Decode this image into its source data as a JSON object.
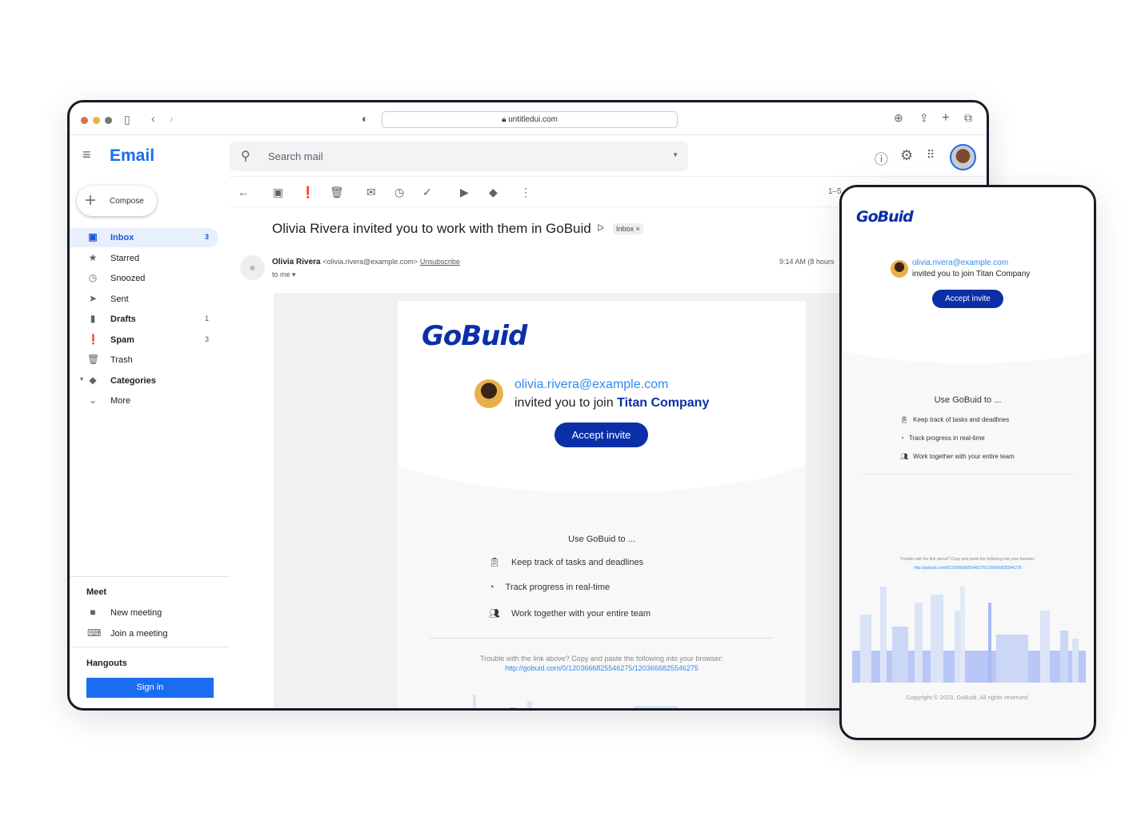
{
  "browser": {
    "url": "untitledui.com"
  },
  "app": {
    "title": "Email",
    "search_placeholder": "Search mail"
  },
  "sidebar": {
    "compose": "Compose",
    "items": [
      {
        "label": "Inbox",
        "count": "3",
        "icon": "inbox-icon"
      },
      {
        "label": "Starred",
        "count": "",
        "icon": "star-icon"
      },
      {
        "label": "Snoozed",
        "count": "",
        "icon": "clock-icon"
      },
      {
        "label": "Sent",
        "count": "",
        "icon": "send-icon"
      },
      {
        "label": "Drafts",
        "count": "1",
        "icon": "draft-icon"
      },
      {
        "label": "Spam",
        "count": "3",
        "icon": "spam-icon"
      },
      {
        "label": "Trash",
        "count": "",
        "icon": "trash-icon"
      },
      {
        "label": "Categories",
        "count": "",
        "icon": "label-icon"
      },
      {
        "label": "More",
        "count": "",
        "icon": "chevron-down-icon"
      }
    ],
    "meet": {
      "title": "Meet",
      "new": "New meeting",
      "join": "Join a meeting"
    },
    "hangouts": {
      "title": "Hangouts",
      "signin": "Sign in"
    }
  },
  "toolbar": {
    "pager": "1–5"
  },
  "email": {
    "subject": "Olivia Rivera invited you to work with them in GoBuid",
    "label": "Inbox ×",
    "sender": "Olivia Rivera",
    "sender_email": "<olivia.rivera@example.com>",
    "unsubscribe": "Unsubscribe",
    "to": "to me ▾",
    "time": "9:14 AM (8 hours"
  },
  "content": {
    "brand": "GoBuid",
    "inviter": "olivia.rivera@example.com",
    "invited_text": "invited you to join ",
    "company": "Titan Company",
    "invited_full": "invited you to join Titan Company",
    "accept": "Accept invite",
    "use_title": "Use GoBuid to ...",
    "features": [
      "Keep track of tasks and deadlines",
      "Track progress in real-time",
      "Work together with your entire team"
    ],
    "trouble": "Trouble with the link above? Copy and paste the following into your browser:",
    "link": "http://gobuid.com/0/1203666825546275/1203666825546275",
    "copyright": "Copyright © 2023, GoBuid. All rights reserved."
  },
  "colors": {
    "brand": "#0b2fa8",
    "link": "#2d8cf0",
    "app_accent": "#1a6cf0"
  }
}
